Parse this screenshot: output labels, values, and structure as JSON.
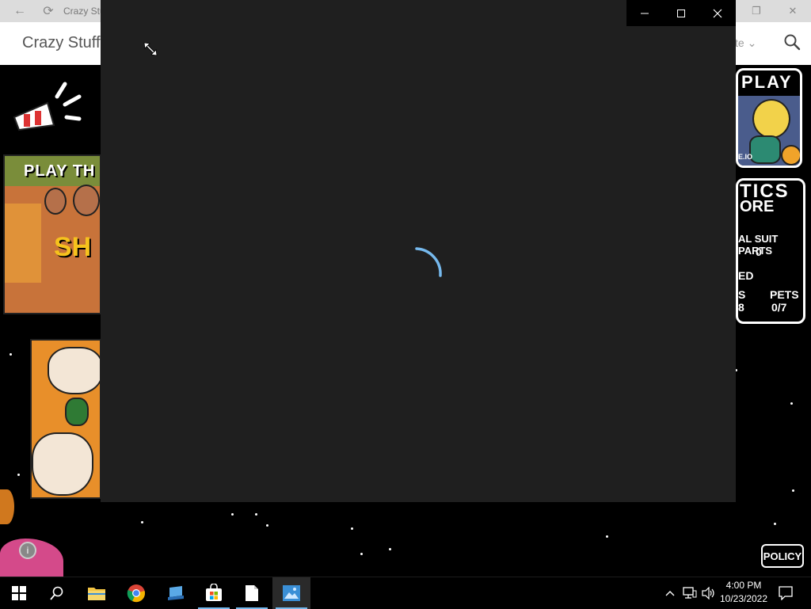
{
  "background_window": {
    "title": "Crazy Stuff",
    "app_name": "Crazy Stuff",
    "language_partial": "te",
    "art": {
      "left_banner_text": "PLAY TH",
      "left_banner_big": "SH",
      "right_card_play": "PLAY",
      "right_card_io": "E.IO",
      "right_stats_title": "TICS",
      "right_stats_sub": "ORE",
      "right_stats_suit": "AL SUIT PARTS",
      "right_stats_suit_value": "0",
      "right_stats_ed": "ED",
      "right_stats_s": "S",
      "right_stats_s_value": "8",
      "right_stats_pets": "PETS",
      "right_stats_pets_value": "0/7"
    },
    "policy_label": "POLICY",
    "info_label": "i"
  },
  "foreground_window": {
    "state": "loading"
  },
  "taskbar": {
    "apps": [
      {
        "name": "start",
        "icon": "windows-logo-icon"
      },
      {
        "name": "search",
        "icon": "search-icon"
      },
      {
        "name": "file-explorer",
        "icon": "folder-icon"
      },
      {
        "name": "chrome",
        "icon": "chrome-icon"
      },
      {
        "name": "app-blue",
        "icon": "app-blue-icon"
      },
      {
        "name": "microsoft-store",
        "icon": "store-icon"
      },
      {
        "name": "document",
        "icon": "document-icon"
      },
      {
        "name": "photos",
        "icon": "photos-icon"
      }
    ],
    "clock": {
      "time": "4:00 PM",
      "date": "10/23/2022"
    }
  },
  "colors": {
    "accent": "#76b9ed",
    "window_bg": "#1f1f1f",
    "taskbar_bg": "#000000"
  }
}
